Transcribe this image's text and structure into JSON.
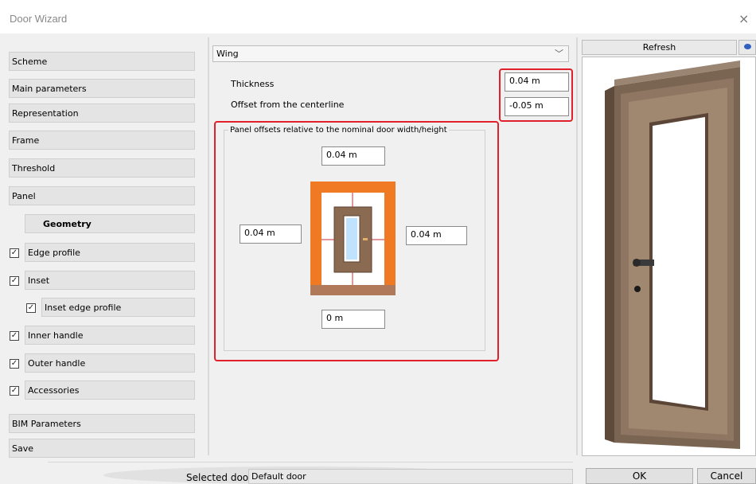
{
  "window": {
    "title": "Door Wizard",
    "close_glyph": "×"
  },
  "nav": {
    "scheme": "Scheme",
    "main_parameters": "Main parameters",
    "representation": "Representation",
    "frame": "Frame",
    "threshold": "Threshold",
    "panel": "Panel",
    "geometry": "Geometry",
    "edge_profile": "Edge profile",
    "inset": "Inset",
    "inset_edge_profile": "Inset edge profile",
    "inner_handle": "Inner handle",
    "outer_handle": "Outer handle",
    "accessories": "Accessories",
    "bim_parameters": "BIM Parameters",
    "save": "Save",
    "check_glyph": "✓"
  },
  "panel": {
    "dropdown_value": "Wing",
    "thickness_label": "Thickness",
    "thickness_value": "0.04 m",
    "offset_label": "Offset from the centerline",
    "offset_value": "-0.05 m",
    "group_title": "Panel offsets relative to the nominal door width/height",
    "top_offset": "0.04 m",
    "left_offset": "0.04 m",
    "right_offset": "0.04 m",
    "bottom_offset": "0 m"
  },
  "preview": {
    "refresh_label": "Refresh"
  },
  "footer": {
    "selected_door_label": "Selected door",
    "selected_door_value": "Default door",
    "ok_label": "OK",
    "cancel_label": "Cancel"
  },
  "colors": {
    "accent_red": "#e0202a",
    "frame_orange": "#f07a24",
    "door_brown": "#8b6a52"
  }
}
